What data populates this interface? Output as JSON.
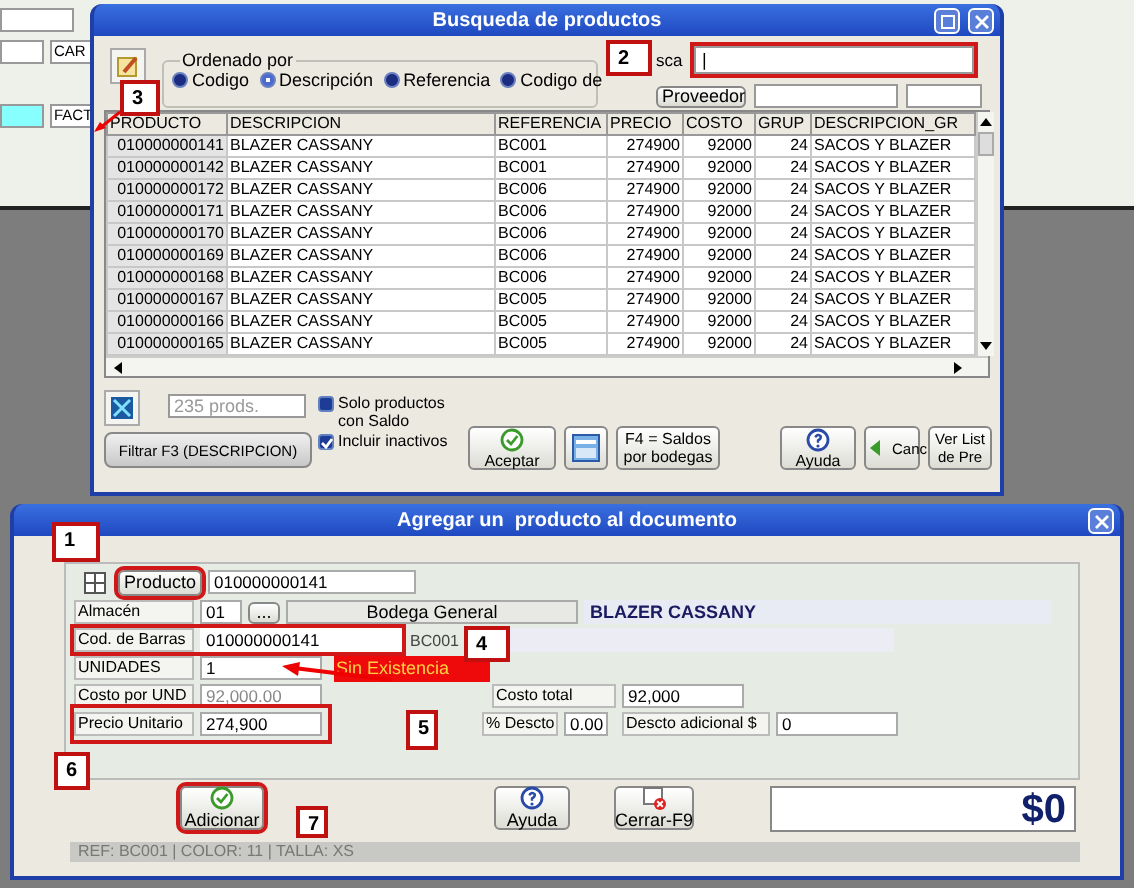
{
  "background_app": {
    "labels": [
      "CAR",
      "FACT"
    ]
  },
  "search_window": {
    "title": "Busqueda de productos",
    "sort_group": {
      "label": "Ordenado por",
      "options": [
        {
          "label": "Codigo",
          "selected": false
        },
        {
          "label": "Descripción",
          "selected": true
        },
        {
          "label": "Referencia",
          "selected": false
        },
        {
          "label": "Codigo de",
          "selected": false
        }
      ]
    },
    "search": {
      "label": "sca",
      "value": "|",
      "highlighted": true
    },
    "supplier_button": "Proveedor",
    "table": {
      "columns": [
        "PRODUCTO",
        "DESCRIPCION",
        "REFERENCIA",
        "PRECIO",
        "COSTO",
        "GRUP",
        "DESCRIPCION_GR"
      ],
      "rows": [
        [
          "010000000141",
          "BLAZER CASSANY",
          "BC001",
          "274900",
          "92000",
          "24",
          "SACOS Y BLAZER"
        ],
        [
          "010000000142",
          "BLAZER CASSANY",
          "BC001",
          "274900",
          "92000",
          "24",
          "SACOS Y BLAZER"
        ],
        [
          "010000000172",
          "BLAZER CASSANY",
          "BC006",
          "274900",
          "92000",
          "24",
          "SACOS Y BLAZER"
        ],
        [
          "010000000171",
          "BLAZER CASSANY",
          "BC006",
          "274900",
          "92000",
          "24",
          "SACOS Y BLAZER"
        ],
        [
          "010000000170",
          "BLAZER CASSANY",
          "BC006",
          "274900",
          "92000",
          "24",
          "SACOS Y BLAZER"
        ],
        [
          "010000000169",
          "BLAZER CASSANY",
          "BC006",
          "274900",
          "92000",
          "24",
          "SACOS Y BLAZER"
        ],
        [
          "010000000168",
          "BLAZER CASSANY",
          "BC006",
          "274900",
          "92000",
          "24",
          "SACOS Y BLAZER"
        ],
        [
          "010000000167",
          "BLAZER CASSANY",
          "BC005",
          "274900",
          "92000",
          "24",
          "SACOS Y BLAZER"
        ],
        [
          "010000000166",
          "BLAZER CASSANY",
          "BC005",
          "274900",
          "92000",
          "24",
          "SACOS Y BLAZER"
        ],
        [
          "010000000165",
          "BLAZER CASSANY",
          "BC005",
          "274900",
          "92000",
          "24",
          "SACOS Y BLAZER"
        ]
      ]
    },
    "count_field": "235 prods.",
    "checkboxes": [
      {
        "label": "Solo productos con Saldo",
        "checked": false
      },
      {
        "label": "Incluir inactivos",
        "checked": true
      }
    ],
    "filter_button": "Filtrar F3 (DESCRIPCION)",
    "buttons": [
      {
        "kind": "accept",
        "label": "Aceptar"
      },
      {
        "kind": "grid"
      },
      {
        "kind": "text",
        "label": "F4 = Saldos por bodegas"
      },
      {
        "kind": "help",
        "label": "Ayuda"
      },
      {
        "kind": "cancel",
        "label": "Canc"
      },
      {
        "kind": "text",
        "label": "Ver List de Pre"
      }
    ]
  },
  "add_window": {
    "title": "Agregar un  producto al documento",
    "product_button": {
      "label": "Producto",
      "highlighted": true
    },
    "product_code": "010000000141",
    "warehouse": {
      "label": "Almacén",
      "code": "01",
      "button": "...",
      "name": "Bodega General"
    },
    "product_name": "BLAZER CASSANY",
    "barcode": {
      "label": "Cod. de Barras",
      "value": "010000000141",
      "highlighted": true
    },
    "reference": "BC001",
    "units": {
      "label": "UNIDADES",
      "value": "1"
    },
    "stock_warning": "Sin Existencia",
    "unit_cost": {
      "label": "Costo por UND",
      "value": "92,000.00"
    },
    "total_cost": {
      "label": "Costo total",
      "value": "92,000"
    },
    "unit_price": {
      "label": "Precio Unitario",
      "value": "274,900",
      "highlighted": true
    },
    "discount": {
      "label": "% Descto",
      "value": "0.00"
    },
    "extra_discount": {
      "label": "Descto adicional $",
      "value": "0"
    },
    "buttons": [
      {
        "kind": "add",
        "label": "Adicionar",
        "highlighted": true
      },
      {
        "kind": "help",
        "label": "Ayuda",
        "highlighted": false
      },
      {
        "kind": "close",
        "label": "Cerrar-F9",
        "highlighted": false
      }
    ],
    "total": "$0",
    "status_bar": "REF: BC001 | COLOR: 11 | TALLA: XS"
  },
  "callouts": [
    "2",
    "3",
    "1",
    "4",
    "5",
    "6",
    "7"
  ]
}
